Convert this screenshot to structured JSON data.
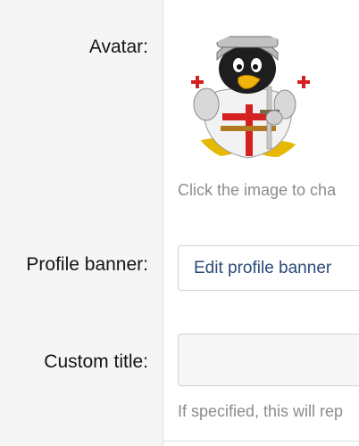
{
  "form": {
    "avatar": {
      "label": "Avatar:",
      "image": "knight-penguin-avatar",
      "hint": "Click the image to cha"
    },
    "profile_banner": {
      "label": "Profile banner:",
      "button_label": "Edit profile banner"
    },
    "custom_title": {
      "label": "Custom title:",
      "value": "",
      "hint": "If specified, this will rep"
    }
  },
  "colors": {
    "label_column_bg": "#f5f5f5",
    "button_text": "#2b4a78",
    "hint_text": "#8c8c8c",
    "border": "#d3d3d3"
  }
}
